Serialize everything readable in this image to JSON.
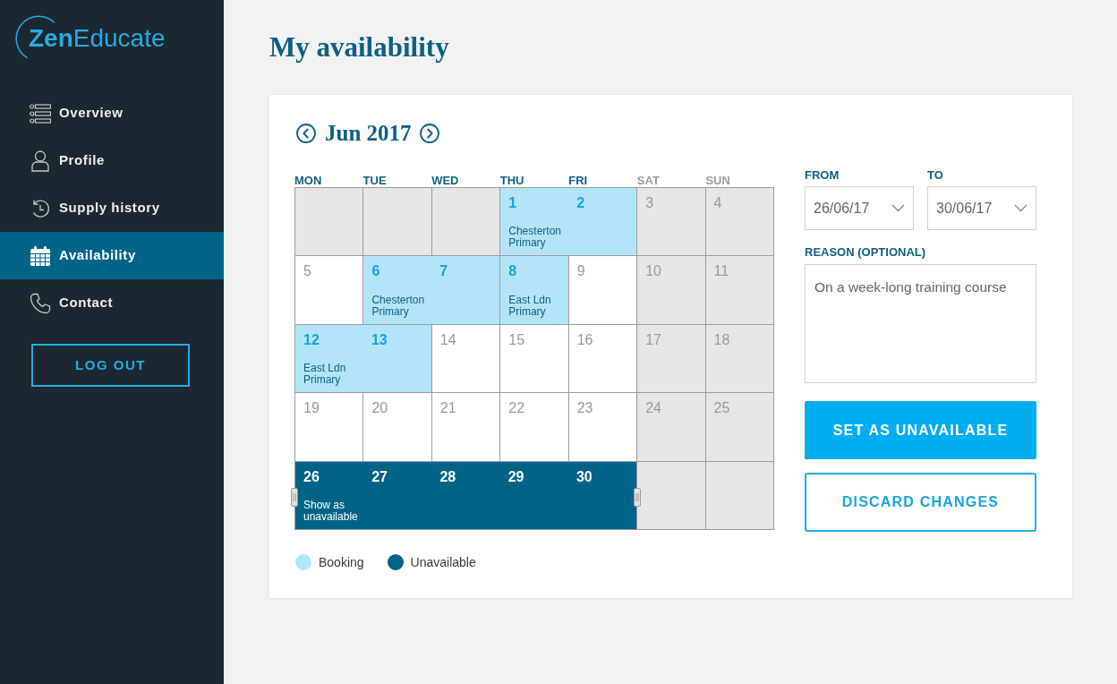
{
  "sidebar": {
    "logo": "**Zen**Educate",
    "items": [
      {
        "label": "Overview",
        "selected": false
      },
      {
        "label": "Profile",
        "selected": false
      },
      {
        "label": "Supply history",
        "selected": false
      },
      {
        "label": "Availability",
        "selected": true
      },
      {
        "label": "Contact",
        "selected": false
      }
    ],
    "logout_button": "LOG OUT"
  },
  "page_title": "My availability",
  "calendar": {
    "month": "Jun 2017",
    "weekdays": [
      {
        "label": "MON",
        "weekend": false
      },
      {
        "label": "TUE",
        "weekend": false
      },
      {
        "label": "WED",
        "weekend": false
      },
      {
        "label": "THU",
        "weekend": false
      },
      {
        "label": "FRI",
        "weekend": false
      },
      {
        "label": "SAT",
        "weekend": true
      },
      {
        "label": "SUN",
        "weekend": true
      }
    ],
    "weeks": [
      [
        {
          "kind": "blank"
        },
        {
          "kind": "blank"
        },
        {
          "kind": "blank"
        },
        {
          "number": "1",
          "kind": "booking",
          "event": "Chesterton Primary"
        },
        {
          "number": "2",
          "kind": "booking"
        },
        {
          "number": "3",
          "kind": "weekend"
        },
        {
          "number": "4",
          "kind": "weekend"
        }
      ],
      [
        {
          "number": "5",
          "kind": "free"
        },
        {
          "number": "6",
          "kind": "booking",
          "event": "Chesterton Primary"
        },
        {
          "number": "7",
          "kind": "booking"
        },
        {
          "number": "8",
          "kind": "booking",
          "event": "East Ldn Primary"
        },
        {
          "number": "9",
          "kind": "free"
        },
        {
          "number": "10",
          "kind": "weekend"
        },
        {
          "number": "11",
          "kind": "weekend"
        }
      ],
      [
        {
          "number": "12",
          "kind": "booking",
          "event": "East Ldn Primary"
        },
        {
          "number": "13",
          "kind": "booking"
        },
        {
          "number": "14",
          "kind": "free"
        },
        {
          "number": "15",
          "kind": "free"
        },
        {
          "number": "16",
          "kind": "free"
        },
        {
          "number": "17",
          "kind": "weekend"
        },
        {
          "number": "18",
          "kind": "weekend"
        }
      ],
      [
        {
          "number": "19",
          "kind": "free"
        },
        {
          "number": "20",
          "kind": "free"
        },
        {
          "number": "21",
          "kind": "free"
        },
        {
          "number": "22",
          "kind": "free"
        },
        {
          "number": "23",
          "kind": "free"
        },
        {
          "number": "24",
          "kind": "weekend"
        },
        {
          "number": "25",
          "kind": "weekend"
        }
      ],
      [
        {
          "number": "26",
          "kind": "unavailable",
          "event": "Show as unavailable"
        },
        {
          "number": "27",
          "kind": "unavailable"
        },
        {
          "number": "28",
          "kind": "unavailable"
        },
        {
          "number": "29",
          "kind": "unavailable"
        },
        {
          "number": "30",
          "kind": "unavailable"
        },
        {
          "kind": "blank"
        },
        {
          "kind": "blank"
        }
      ]
    ]
  },
  "legend": [
    {
      "label": "Booking",
      "color": "#b3e5f8"
    },
    {
      "label": "Unavailable",
      "color": "#006488"
    }
  ],
  "form": {
    "from": {
      "label": "FROM",
      "value": "26/06/17"
    },
    "to": {
      "label": "TO",
      "value": "30/06/17"
    },
    "reason": {
      "label": "REASON (OPTIONAL)",
      "value": "On a week-long training course"
    },
    "buttons": [
      {
        "label": "SET AS UNAVAILABLE",
        "kind": "primary"
      },
      {
        "label": "DISCARD CHANGES",
        "kind": "secondary"
      }
    ]
  }
}
